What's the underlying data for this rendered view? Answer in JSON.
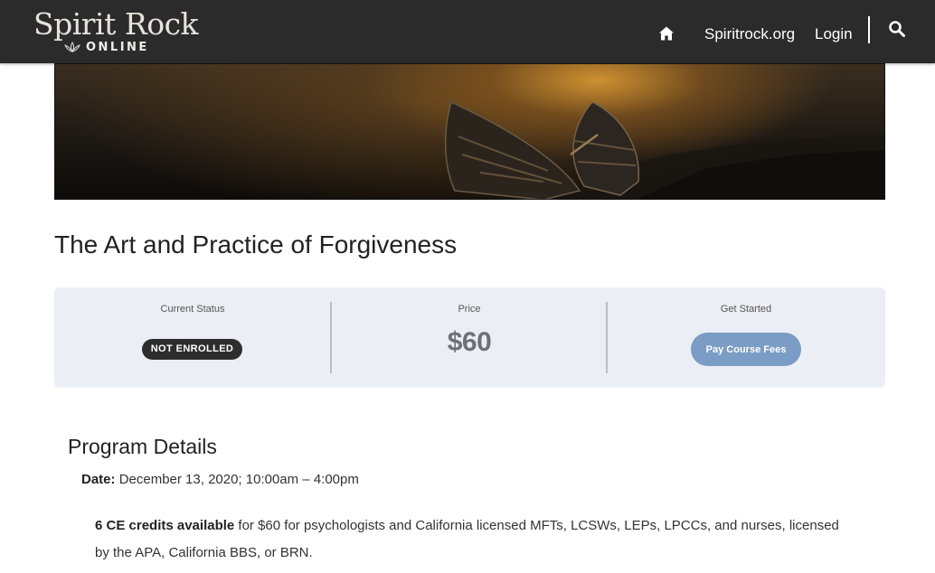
{
  "header": {
    "logo_main": "Spirit Rock",
    "logo_sub": "ONLINE",
    "nav": {
      "home_icon": "home-icon",
      "site_link": "Spiritrock.org",
      "login_link": "Login",
      "search_icon": "search-icon"
    }
  },
  "banner": {
    "image": "two wooden boats on a shore at dusk"
  },
  "course": {
    "title": "The Art and Practice of Forgiveness"
  },
  "status_panel": {
    "status_label": "Current Status",
    "status_value": "NOT ENROLLED",
    "price_label": "Price",
    "price_value": "$60",
    "start_label": "Get Started",
    "start_button": "Pay Course Fees"
  },
  "program": {
    "heading": "Program Details",
    "date_label": "Date:",
    "date_value": "December 13, 2020; 10:00am – 4:00pm",
    "ce_bold": "6 CE credits available",
    "ce_text": "for $60 for psychologists and California licensed MFTs, LCSWs, LEPs, LPCCs, and nurses, licensed by the APA, California BBS, or BRN."
  },
  "colors": {
    "header_bg": "#2b2b2b",
    "panel_bg": "#ebeff5",
    "button_bg": "#7b9cc4",
    "badge_bg": "#2d2d2d"
  }
}
